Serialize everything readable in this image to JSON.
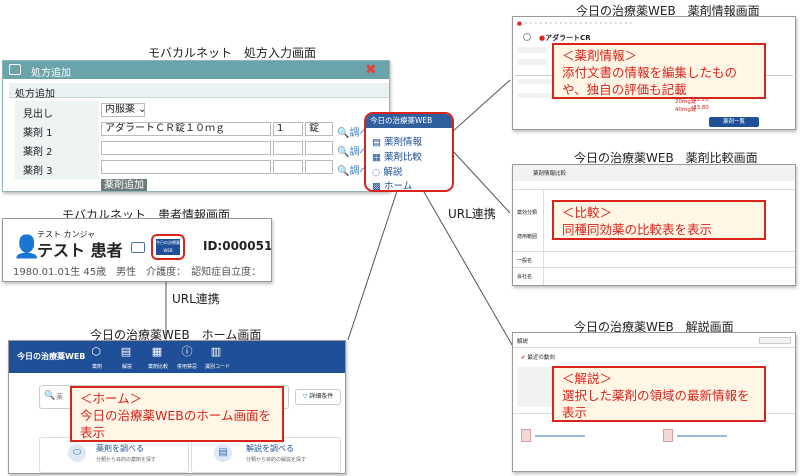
{
  "captions": {
    "prescription_screen": "モバカルネット　処方入力画面",
    "patient_screen": "モバカルネット　患者情報画面",
    "drug_info_screen": "今日の治療薬WEB　薬剤情報画面",
    "comparison_screen": "今日の治療薬WEB　薬剤比較画面",
    "commentary_screen": "今日の治療薬WEB　解説画面",
    "home_screen": "今日の治療薬WEB　ホーム画面",
    "url_link_1": "URL連携",
    "url_link_2": "URL連携"
  },
  "prescription": {
    "window_title": "処方追加",
    "section_title": "処方追加",
    "heading_label": "見出し",
    "heading_value": "内服薬",
    "drug_labels": [
      "薬剤 1",
      "薬剤 2",
      "薬剤 3"
    ],
    "drug1_name": "アダラートＣＲ錠１０ｍｇ",
    "drug1_qty": "1",
    "drug1_unit": "錠",
    "lookup_label": "調べ",
    "add_button": "薬剤追加"
  },
  "popup_menu": {
    "title": "今日の治療薬WEB",
    "items": [
      "薬剤情報",
      "薬剤比較",
      "解説",
      "ホーム"
    ]
  },
  "patient": {
    "kana": "テスト カンジャ",
    "name": "テスト 患者",
    "id": "ID:000051",
    "details": "1980.01.01生 45歳　男性　介護度：　認知症自立度：",
    "badge": "今日の治療薬WEB"
  },
  "drug_info": {
    "drug_name": "アダラートCR",
    "dose_a": "20mg錠",
    "dose_b": "40mg錠",
    "price_a": "11.20",
    "price_b": "23.80",
    "btn": "薬剤一覧",
    "callout_title": "＜薬剤情報＞",
    "callout_body": "添付文書の情報を編集したものや、独自の評価も記載"
  },
  "comparison": {
    "title": "薬剤情報比較",
    "row_labels": [
      "薬効分類",
      "適用範囲",
      "一般名",
      "会社名"
    ],
    "callout_title": "＜比較＞",
    "callout_body": "同種同効薬の比較表を表示"
  },
  "commentary": {
    "header": "解説",
    "section": "最近の動向",
    "callout_title": "＜解説＞",
    "callout_body": "選択した薬剤の領域の最新情報を表示"
  },
  "home": {
    "app_title": "今日の治療薬WEB",
    "nav": [
      "薬剤",
      "解説",
      "薬剤比較",
      "併用禁忌",
      "識別コード"
    ],
    "search_placeholder": "薬",
    "filter_label": "詳細条件",
    "card1_title": "薬剤を調べる",
    "card1_sub": "分類から目的の薬剤を探す",
    "card2_title": "解説を調べる",
    "card2_sub": "分類から目的の解説を探す",
    "callout_title": "＜ホーム＞",
    "callout_body": "今日の治療薬WEBのホーム画面を表示"
  },
  "colors": {
    "accent_red": "#d9241c",
    "callout_bg": "#fff6e5",
    "teal": "#5b9aa0",
    "navy": "#1e4f97",
    "blue_link": "#3b7fc4"
  }
}
